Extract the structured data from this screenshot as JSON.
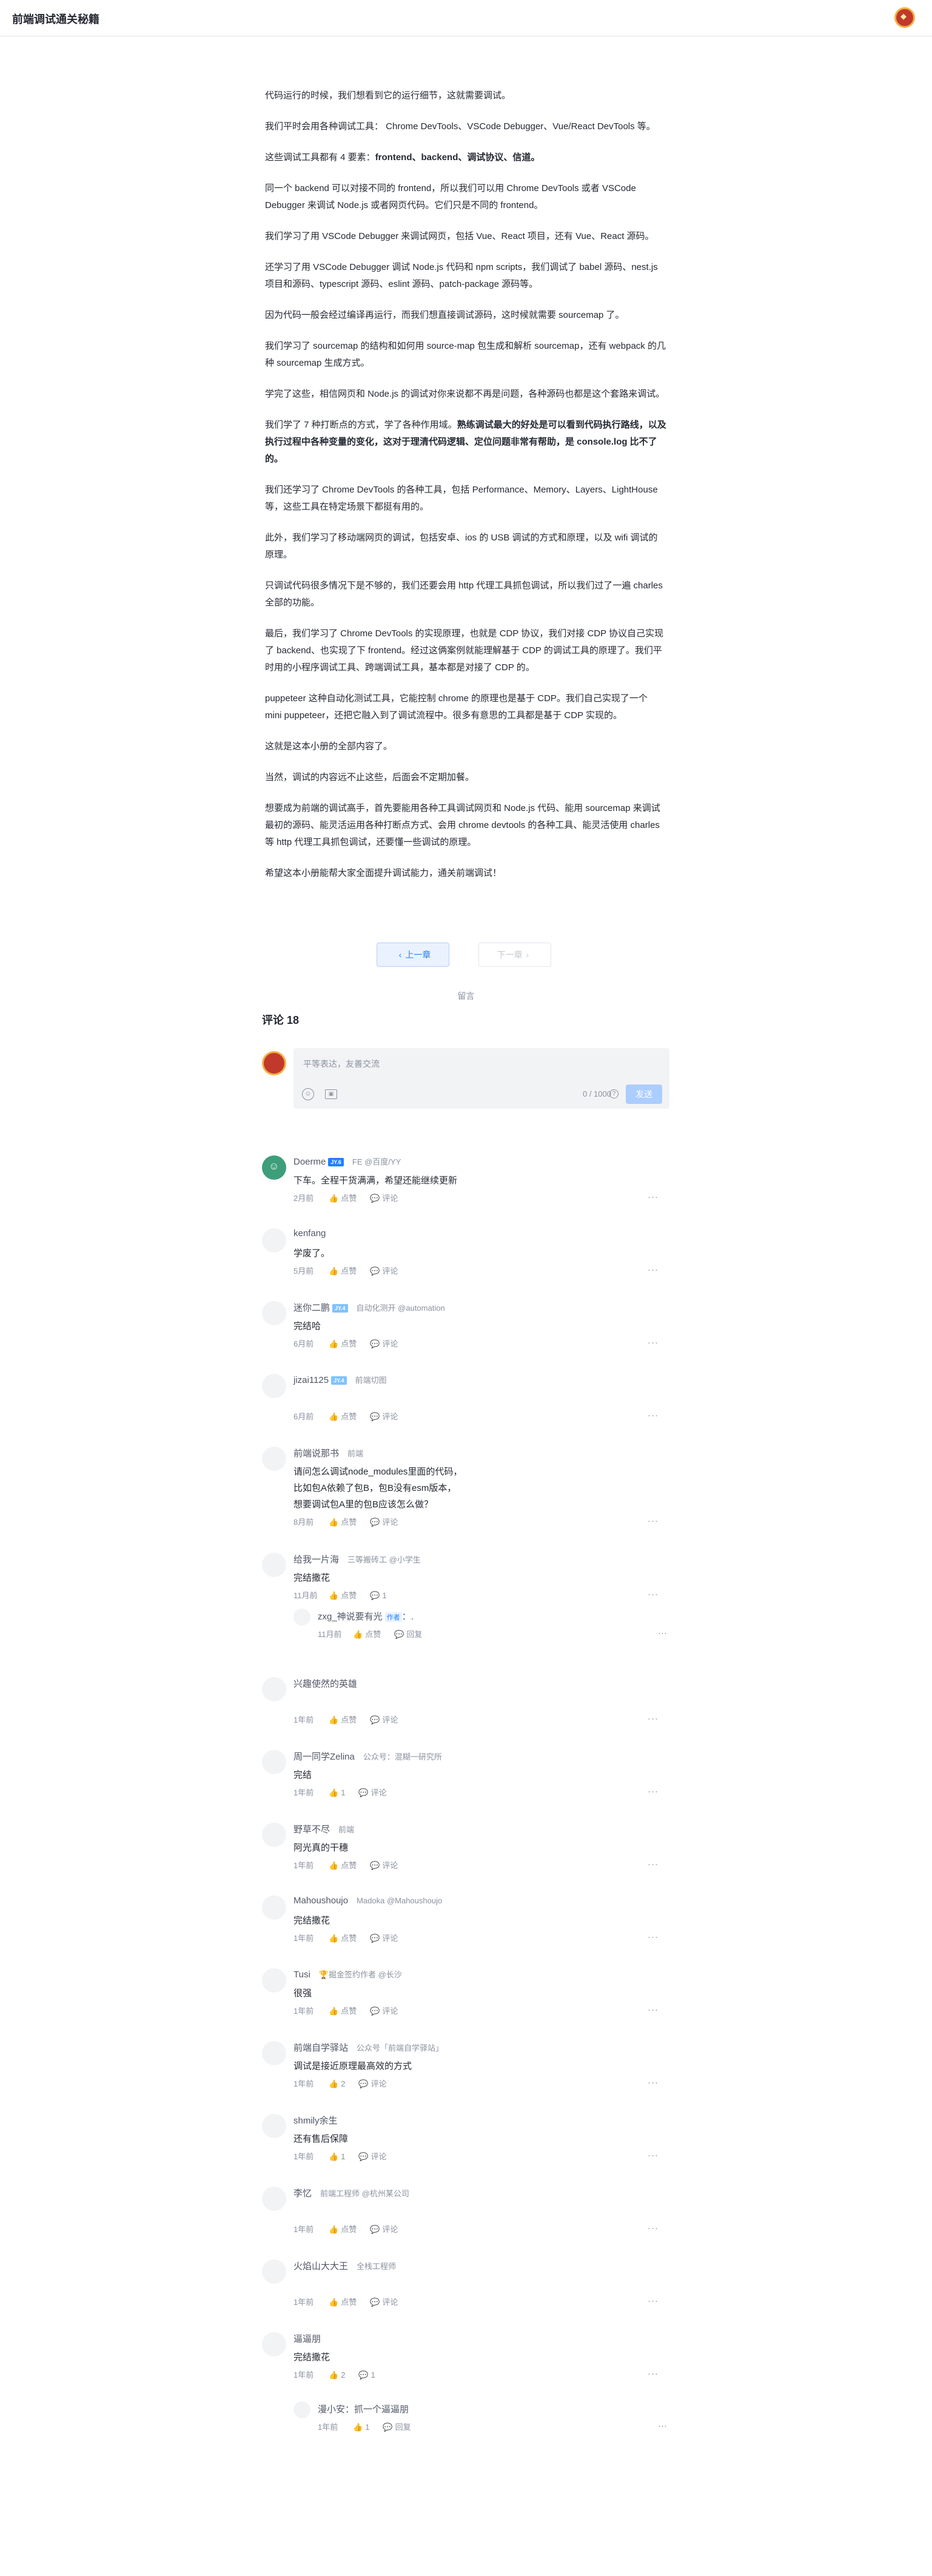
{
  "header": {
    "title": "前端调试通关秘籍"
  },
  "article": {
    "paragraphs": [
      "代码运行的时候，我们想看到它的运行细节，这就需要调试。",
      "我们平时会用各种调试工具： Chrome DevTools、VSCode Debugger、Vue/React DevTools 等。",
      "这些调试工具都有 4 要素：",
      "同一个 backend 可以对接不同的 frontend，所以我们可以用 Chrome DevTools 或者 VSCode Debugger 来调试 Node.js 或者网页代码。它们只是不同的 frontend。",
      "我们学习了用 VSCode Debugger 来调试网页，包括 Vue、React 项目，还有 Vue、React 源码。",
      "还学习了用 VSCode Debugger 调试 Node.js 代码和 npm scripts，我们调试了 babel 源码、nest.js 项目和源码、typescript 源码、eslint 源码、patch-package 源码等。",
      "因为代码一般会经过编译再运行，而我们想直接调试源码，这时候就需要 sourcemap 了。",
      "我们学习了 sourcemap 的结构和如何用 source-map 包生成和解析 sourcemap，还有 webpack 的几种 sourcemap 生成方式。",
      "学完了这些，相信网页和 Node.js 的调试对你来说都不再是问题，各种源码也都是这个套路来调试。",
      "我们学了 7 种打断点的方式，学了各种作用域。",
      "我们还学习了 Chrome DevTools 的各种工具，包括 Performance、Memory、Layers、LightHouse 等，这些工具在特定场景下都挺有用的。",
      "此外，我们学习了移动端网页的调试，包括安卓、ios 的 USB 调试的方式和原理，以及 wifi 调试的原理。",
      "只调试代码很多情况下是不够的，我们还要会用 http 代理工具抓包调试，所以我们过了一遍 charles 全部的功能。",
      "最后，我们学习了 Chrome DevTools 的实现原理，也就是 CDP 协议，我们对接 CDP 协议自己实现了 backend、也实现了下 frontend。经过这俩案例就能理解基于 CDP 的调试工具的原理了。我们平时用的小程序调试工具、跨端调试工具，基本都是对接了 CDP 的。",
      "puppeteer 这种自动化测试工具，它能控制 chrome 的原理也是基于 CDP。我们自己实现了一个 mini puppeteer，还把它融入到了调试流程中。很多有意思的工具都是基于 CDP 实现的。",
      "这就是这本小册的全部内容了。",
      "当然，调试的内容远不止这些，后面会不定期加餐。",
      "想要成为前端的调试高手，首先要能用各种工具调试网页和 Node.js 代码、能用 sourcemap 来调试最初的源码、能灵活运用各种打断点方式、会用 chrome devtools 的各种工具、能灵活使用 charles 等 http 代理工具抓包调试，还要懂一些调试的原理。",
      "希望这本小册能帮大家全面提升调试能力，通关前端调试！"
    ],
    "bold_elements": "frontend、backend、调试协议、信道。",
    "bold_breakpoints": "熟练调试最大的好处是可以看到代码执行路线，以及执行过程中各种变量的变化，这对于理清代码逻辑、定位问题非常有帮助，是 console.log 比不了的。"
  },
  "pager": {
    "prev": "上一章",
    "next": "下一章"
  },
  "comments_section": {
    "label": "留言",
    "title": "评论 18",
    "placeholder": "平等表达，友善交流",
    "count": "0 / 1000",
    "send": "发送"
  },
  "comments": [
    {
      "name": "Doerme",
      "badge": "JY.6",
      "job": "FE @百度/YY",
      "text": "下车。全程干货满满，希望还能继续更新",
      "time": "2月前",
      "like": "点赞",
      "reply": "评论"
    },
    {
      "name": "kenfang",
      "badge": "",
      "job": "",
      "text": "学废了。",
      "time": "5月前",
      "like": "点赞",
      "reply": "评论"
    },
    {
      "name": "迷你二鹏",
      "badge": "JY.4",
      "job": "自动化测开 @automation",
      "text": "完结哈",
      "time": "6月前",
      "like": "点赞",
      "reply": "评论"
    },
    {
      "name": "jizai1125",
      "badge": "JY.4",
      "job": "前端切图",
      "text": "",
      "time": "6月前",
      "like": "点赞",
      "reply": "评论"
    },
    {
      "name": "前端说那书",
      "badge": "",
      "job": "前端",
      "text": "请问怎么调试node_modules里面的代码，\n比如包A依赖了包B，包B没有esm版本，\n想要调试包A里的包B应该怎么做？",
      "time": "8月前",
      "like": "点赞",
      "reply": "评论"
    },
    {
      "name": "给我一片海",
      "badge": "",
      "job": "三等搬砖工 @小学生",
      "text": "完结撒花",
      "time": "11月前",
      "like": "点赞",
      "reply": "1"
    },
    {
      "name": "兴趣使然的英雄",
      "badge": "",
      "job": "",
      "text": "",
      "time": "1年前",
      "like": "点赞",
      "reply": "评论"
    },
    {
      "name": "周一同学Zelina",
      "badge": "",
      "job": "公众号：混糊一研究所",
      "text": "完结",
      "time": "1年前",
      "like": "1",
      "reply": "评论"
    },
    {
      "name": "野草不尽",
      "badge": "",
      "job": "前端",
      "text": "阿光真的干穗",
      "time": "1年前",
      "like": "点赞",
      "reply": "评论"
    },
    {
      "name": "Mahoushoujo",
      "badge": "",
      "job": "Madoka @Mahoushoujo",
      "text": "完结撒花",
      "time": "1年前",
      "like": "点赞",
      "reply": "评论"
    },
    {
      "name": "Tusi",
      "badge": "",
      "job": "🏆掘金签约作者 @长沙",
      "text": "很强",
      "time": "1年前",
      "like": "点赞",
      "reply": "评论"
    },
    {
      "name": "前端自学驿站",
      "badge": "",
      "job": "公众号「前端自学驿站」",
      "text": "调试是接近原理最高效的方式",
      "time": "1年前",
      "like": "2",
      "reply": "评论"
    },
    {
      "name": "shmily余生",
      "badge": "",
      "job": "",
      "text": " 还有售后保障",
      "time": "1年前",
      "like": "1",
      "reply": "评论"
    },
    {
      "name": "李忆",
      "badge": "",
      "job": "前端工程师 @杭州某公司",
      "text": "",
      "time": "1年前",
      "like": "点赞",
      "reply": "评论"
    },
    {
      "name": "火焰山大大王",
      "badge": "",
      "job": "全栈工程师",
      "text": "",
      "time": "1年前",
      "like": "点赞",
      "reply": "评论"
    },
    {
      "name": "逼逼朋",
      "badge": "",
      "job": "",
      "text": "完结撒花",
      "time": "1年前",
      "like": "2",
      "reply": "1"
    }
  ],
  "replies": [
    {
      "name": "zxg_神说要有光",
      "tag": "作者",
      "text": "：.",
      "time": "11月前",
      "like": "点赞",
      "reply": "回复"
    },
    {
      "name": "漫小安：抓一个逼逼朋",
      "tag": "",
      "text": "",
      "time": "1年前",
      "like": "1",
      "reply": "回复"
    }
  ],
  "icons": {
    "like": "thumb-up-icon",
    "reply": "comment-icon",
    "more": "more-icon",
    "prev": "chevron-left-icon",
    "next": "chevron-right-icon"
  },
  "colors": {
    "accent": "#1e80ff",
    "muted": "#8a919f",
    "text": "#252933"
  }
}
